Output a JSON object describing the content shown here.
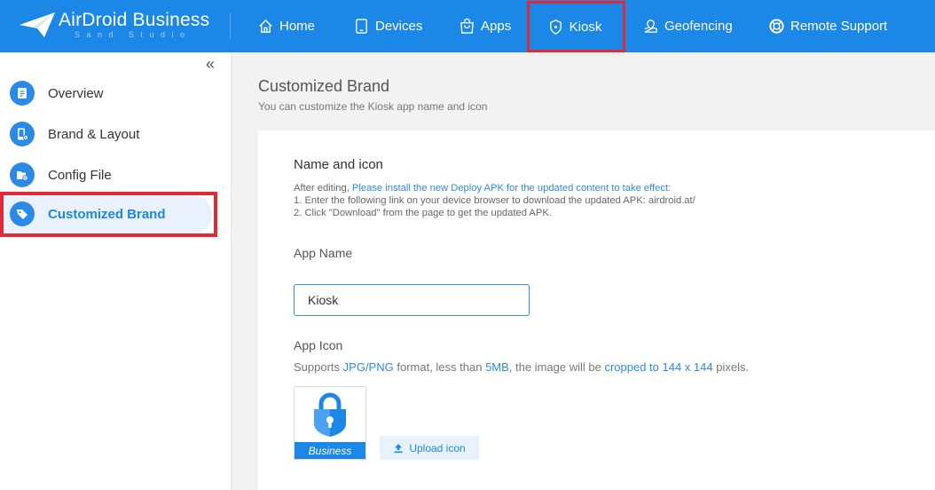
{
  "header": {
    "brand": "AirDroid Business",
    "brand_sub": "Sand Studio",
    "nav": {
      "home": "Home",
      "devices": "Devices",
      "apps": "Apps",
      "kiosk": "Kiosk",
      "geofencing": "Geofencing",
      "remote_support": "Remote Support"
    },
    "active_nav": "Kiosk"
  },
  "sidebar": {
    "collapse_icon": "double-chevron-left-icon",
    "items": [
      {
        "label": "Overview",
        "icon": "document-icon"
      },
      {
        "label": "Brand & Layout",
        "icon": "phone-settings-icon"
      },
      {
        "label": "Config File",
        "icon": "folder-settings-icon"
      },
      {
        "label": "Customized Brand",
        "icon": "tag-icon"
      }
    ],
    "active_item": "Customized Brand"
  },
  "main": {
    "title": "Customized Brand",
    "subtitle": "You can customize the Kiosk app name and icon",
    "section_title": "Name and icon",
    "note": {
      "prefix": "After editing, ",
      "link": "Please install the new Deploy APK for the updated content to take effect:",
      "line1": "1. Enter the following link on your device browser to download the updated APK: airdroid.at/",
      "line2": "2. Click \"Download\" from the page to get the updated APK."
    },
    "app_name_label": "App Name",
    "app_name_value": "Kiosk",
    "app_icon_label": "App Icon",
    "supports": {
      "t1": "Supports ",
      "l1": "JPG/PNG",
      "t2": " format, less than ",
      "l2": "5MB",
      "t3": ", the image will be ",
      "l3": "cropped to 144 x 144",
      "t4": " pixels."
    },
    "icon_banner": "Business",
    "upload_label": "Upload icon"
  },
  "colors": {
    "brand_blue": "#1b87e6",
    "highlight_red": "#e02a35",
    "link_blue": "#2b8ae6"
  }
}
